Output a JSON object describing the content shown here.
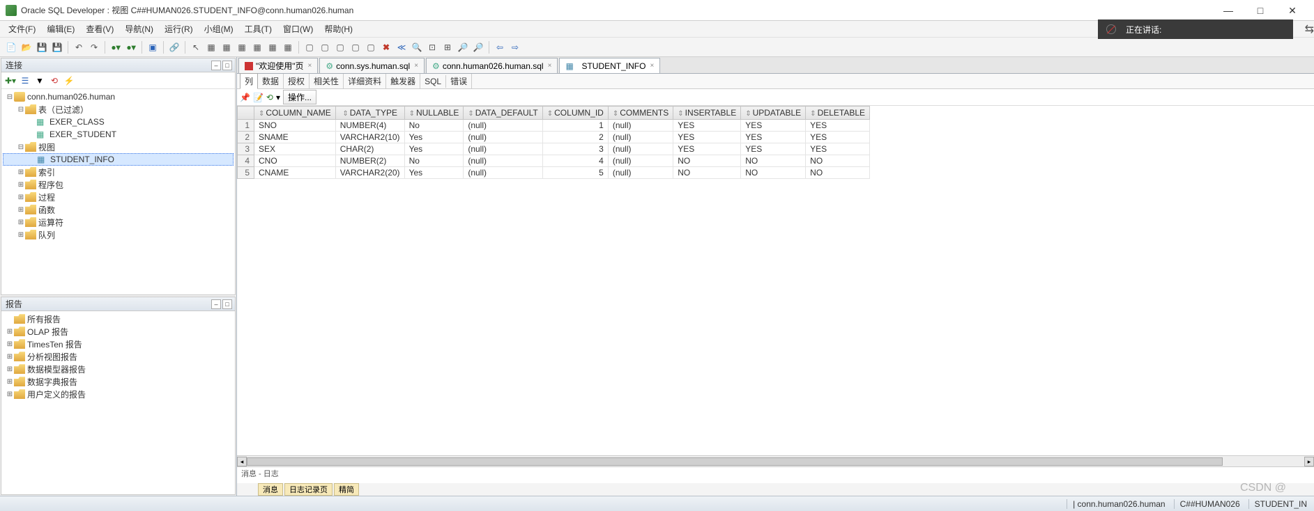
{
  "window": {
    "title": "Oracle SQL Developer : 视图 C##HUMAN026.STUDENT_INFO@conn.human026.human"
  },
  "menu": [
    "文件(F)",
    "编辑(E)",
    "查看(V)",
    "导航(N)",
    "运行(R)",
    "小组(M)",
    "工具(T)",
    "窗口(W)",
    "帮助(H)"
  ],
  "speaking_label": "正在讲话:",
  "panels": {
    "connections": {
      "title": "连接",
      "tree": [
        {
          "d": 0,
          "tw": "⊟",
          "ico": "db",
          "label": "conn.human026.human"
        },
        {
          "d": 1,
          "tw": "⊟",
          "ico": "fld",
          "label": "表（已过滤）"
        },
        {
          "d": 2,
          "tw": "",
          "ico": "tbl",
          "label": "EXER_CLASS"
        },
        {
          "d": 2,
          "tw": "",
          "ico": "tbl",
          "label": "EXER_STUDENT"
        },
        {
          "d": 1,
          "tw": "⊟",
          "ico": "fld",
          "label": "视图"
        },
        {
          "d": 2,
          "tw": "",
          "ico": "view",
          "label": "STUDENT_INFO",
          "sel": true
        },
        {
          "d": 1,
          "tw": "⊞",
          "ico": "fld",
          "label": "索引"
        },
        {
          "d": 1,
          "tw": "⊞",
          "ico": "fld",
          "label": "程序包"
        },
        {
          "d": 1,
          "tw": "⊞",
          "ico": "fld",
          "label": "过程"
        },
        {
          "d": 1,
          "tw": "⊞",
          "ico": "fld",
          "label": "函数"
        },
        {
          "d": 1,
          "tw": "⊞",
          "ico": "fld",
          "label": "运算符"
        },
        {
          "d": 1,
          "tw": "⊞",
          "ico": "fld",
          "label": "队列"
        }
      ]
    },
    "reports": {
      "title": "报告",
      "tree": [
        {
          "d": 0,
          "tw": "",
          "ico": "fld",
          "label": "所有报告"
        },
        {
          "d": 0,
          "tw": "⊞",
          "ico": "fld",
          "label": "OLAP 报告"
        },
        {
          "d": 0,
          "tw": "⊞",
          "ico": "fld",
          "label": "TimesTen 报告"
        },
        {
          "d": 0,
          "tw": "⊞",
          "ico": "fld",
          "label": "分析视图报告"
        },
        {
          "d": 0,
          "tw": "⊞",
          "ico": "fld",
          "label": "数据模型器报告"
        },
        {
          "d": 0,
          "tw": "⊞",
          "ico": "fld",
          "label": "数据字典报告"
        },
        {
          "d": 0,
          "tw": "⊞",
          "ico": "fld",
          "label": "用户定义的报告"
        }
      ]
    }
  },
  "editor": {
    "tabs": [
      {
        "label": "\"欢迎使用\"页",
        "ico": "red-sq"
      },
      {
        "label": "conn.sys.human.sql",
        "ico": "gear"
      },
      {
        "label": "conn.human026.human.sql",
        "ico": "gear"
      },
      {
        "label": "STUDENT_INFO",
        "ico": "view",
        "active": true
      }
    ],
    "subtabs": [
      "列",
      "数据",
      "授权",
      "相关性",
      "详细资料",
      "触发器",
      "SQL",
      "错误"
    ],
    "actions_label": "操作...",
    "grid": {
      "headers": [
        "",
        "COLUMN_NAME",
        "DATA_TYPE",
        "NULLABLE",
        "DATA_DEFAULT",
        "COLUMN_ID",
        "COMMENTS",
        "INSERTABLE",
        "UPDATABLE",
        "DELETABLE"
      ],
      "rows": [
        [
          "1",
          "SNO",
          "NUMBER(4)",
          "No",
          "(null)",
          "1",
          "(null)",
          "YES",
          "YES",
          "YES"
        ],
        [
          "2",
          "SNAME",
          "VARCHAR2(10)",
          "Yes",
          "(null)",
          "2",
          "(null)",
          "YES",
          "YES",
          "YES"
        ],
        [
          "3",
          "SEX",
          "CHAR(2)",
          "Yes",
          "(null)",
          "3",
          "(null)",
          "YES",
          "YES",
          "YES"
        ],
        [
          "4",
          "CNO",
          "NUMBER(2)",
          "No",
          "(null)",
          "4",
          "(null)",
          "NO",
          "NO",
          "NO"
        ],
        [
          "5",
          "CNAME",
          "VARCHAR2(20)",
          "Yes",
          "(null)",
          "5",
          "(null)",
          "NO",
          "NO",
          "NO"
        ]
      ]
    },
    "log_title": "消息 - 日志",
    "log_tabs": [
      "消息",
      "日志记录页",
      "精简"
    ]
  },
  "status": {
    "right1": "| conn.human026.human",
    "right2": "C##HUMAN026",
    "right3": "STUDENT_IN"
  },
  "watermark": "CSDN @"
}
